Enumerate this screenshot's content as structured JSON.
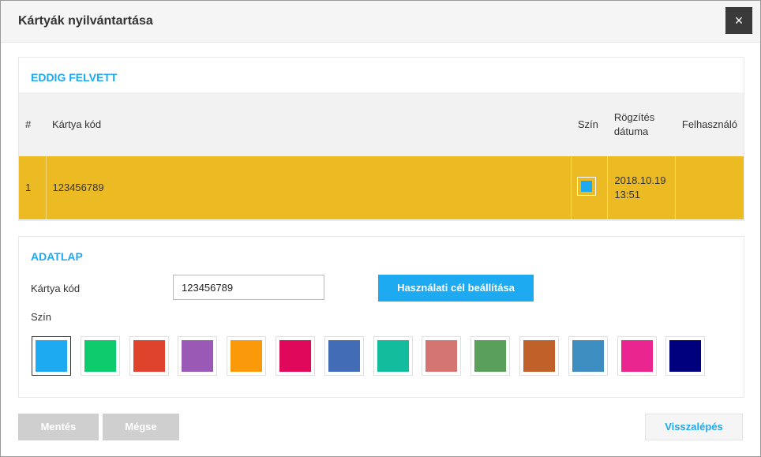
{
  "dialog": {
    "title": "Kártyák nyilvántartása",
    "close_icon": "×"
  },
  "recorded": {
    "section_title": "EDDIG FELVETT",
    "columns": {
      "index": "#",
      "code": "Kártya kód",
      "color": "Szín",
      "date_line1": "Rögzítés",
      "date_line2": "dátuma",
      "user": "Felhasználó"
    },
    "rows": [
      {
        "index": "1",
        "code": "123456789",
        "color": "#1eaaf1",
        "date_line1": "2018.10.19",
        "date_line2": "13:51",
        "user": ""
      }
    ],
    "row_highlight": "#ecbb23"
  },
  "datasheet": {
    "section_title": "ADATLAP",
    "code_label": "Kártya kód",
    "code_value": "123456789",
    "purpose_button": "Használati cél beállítása",
    "color_label": "Szín",
    "colors": [
      "#1eaaf1",
      "#0ecb6d",
      "#e0432c",
      "#9b59b6",
      "#fa9a0a",
      "#e0085a",
      "#426cb6",
      "#13bc9c",
      "#d47572",
      "#5aa05a",
      "#c0612a",
      "#3d8dc1",
      "#eb2590",
      "#00007f"
    ],
    "selected_color": "#1eaaf1"
  },
  "footer": {
    "save": "Mentés",
    "cancel": "Mégse",
    "back": "Visszalépés"
  }
}
